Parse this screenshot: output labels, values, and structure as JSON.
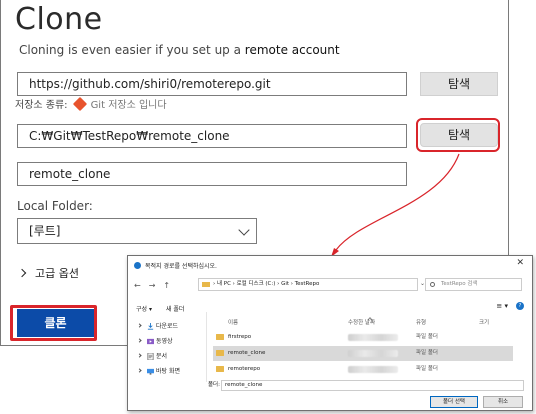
{
  "clone": {
    "title": "Clone",
    "subtitle_prefix": "Cloning is even easier if you set up a ",
    "subtitle_link": "remote account",
    "repo_url": "https://github.com/shiri0/remoterepo.git",
    "browse_label_1": "탐색",
    "repo_type_label": "저장소 종류:",
    "repo_type_value": "Git 저장소 입니다",
    "path_value": "C:₩Git₩TestRepo₩remote_clone",
    "browse_label_2": "탐색",
    "name_value": "remote_clone",
    "local_folder_label": "Local Folder:",
    "local_folder_value": "[루트]",
    "advanced_label": "고급 옵션",
    "clone_button": "클론"
  },
  "folder_dialog": {
    "title": "목적지 경로를 선택하십시오.",
    "close": "✕",
    "nav": [
      "←",
      "→",
      "↑"
    ],
    "address": "› 내 PC › 로컬 디스크 (C:) › Git › TestRepo",
    "address_controls": [
      "⌄",
      "↻"
    ],
    "search_placeholder": "TestRepo 검색",
    "toolbar": [
      "구성 ▾",
      "새 폴더"
    ],
    "view_controls": [
      "≡ ▾"
    ],
    "help": "?",
    "sidebar": [
      {
        "label": "다운로드",
        "icon": "download-icon"
      },
      {
        "label": "동영상",
        "icon": "video-icon"
      },
      {
        "label": "문서",
        "icon": "document-icon"
      },
      {
        "label": "바탕 화면",
        "icon": "desktop-icon"
      }
    ],
    "columns": {
      "name": "이름",
      "date": "수정한 날짜",
      "type": "유형",
      "size": "크기"
    },
    "files": [
      {
        "name": "firstrepo",
        "type": "파일 폴더",
        "selected": false
      },
      {
        "name": "remote_clone",
        "type": "파일 폴더",
        "selected": true
      },
      {
        "name": "remoterepo",
        "type": "파일 폴더",
        "selected": false
      }
    ],
    "folder_label": "폴더:",
    "folder_value": "remote_clone",
    "select_button": "폴더 선택",
    "cancel_button": "취소"
  },
  "colors": {
    "highlight": "#d9252b",
    "primary": "#0c4ba8",
    "folder": "#e8b84a"
  }
}
